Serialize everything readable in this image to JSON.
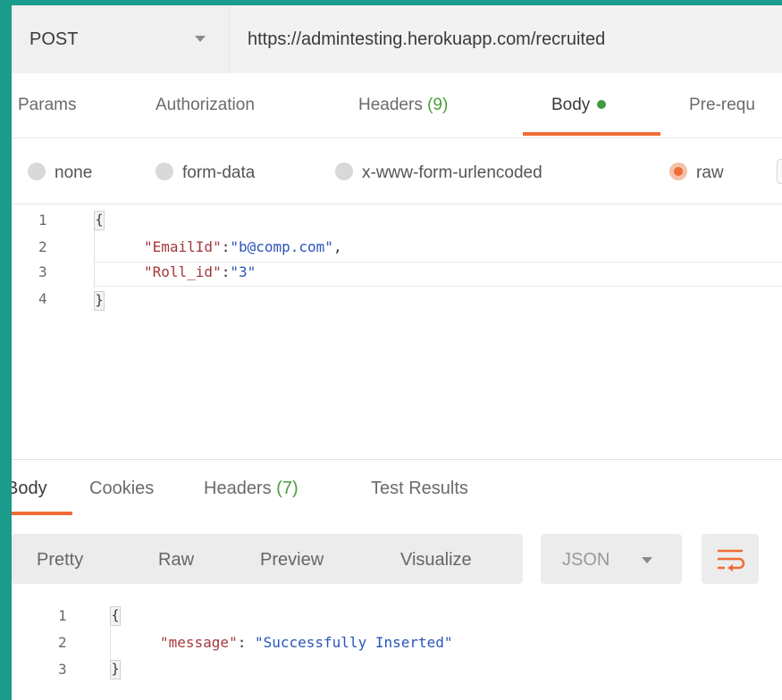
{
  "request": {
    "method": "POST",
    "url": "https://admintesting.herokuapp.com/recruited"
  },
  "request_tabs": [
    {
      "label": "Params"
    },
    {
      "label": "Authorization"
    },
    {
      "label": "Headers",
      "count": "(9)"
    },
    {
      "label": "Body"
    },
    {
      "label": "Pre-requ"
    }
  ],
  "body_types": [
    {
      "label": "none"
    },
    {
      "label": "form-data"
    },
    {
      "label": "x-www-form-urlencoded"
    },
    {
      "label": "raw",
      "selected": true
    }
  ],
  "request_body": {
    "line_numbers": [
      "1",
      "2",
      "3",
      "4"
    ],
    "open_brace": "{",
    "close_brace": "}",
    "line2_key": "\"EmailId\"",
    "line2_sep": ":",
    "line2_value": "\"b@comp.com\"",
    "line2_trail": ",",
    "line3_key": "\"Roll_id\"",
    "line3_sep": ":",
    "line3_value": "\"3\""
  },
  "response_tabs": [
    {
      "label": "Body"
    },
    {
      "label": "Cookies"
    },
    {
      "label": "Headers",
      "count": "(7)"
    },
    {
      "label": "Test Results"
    }
  ],
  "response_view_modes": [
    "Pretty",
    "Raw",
    "Preview",
    "Visualize"
  ],
  "response_format": "JSON",
  "response_body": {
    "line_numbers": [
      "1",
      "2",
      "3"
    ],
    "open_brace": "{",
    "close_brace": "}",
    "line2_key": "\"message\"",
    "line2_sep": ": ",
    "line2_value": "\"Successfully Inserted\""
  },
  "icons": {
    "method_dropdown": "chevron-down-icon",
    "format_dropdown": "chevron-down-icon",
    "wrap": "wrap-lines-icon"
  },
  "colors": {
    "accent": "#ef6c35",
    "frame": "#1b9b8c",
    "status_dot": "#3c9c3c",
    "count": "#4a9e3c",
    "json_key": "#a6373a",
    "json_value": "#2a55b8"
  }
}
